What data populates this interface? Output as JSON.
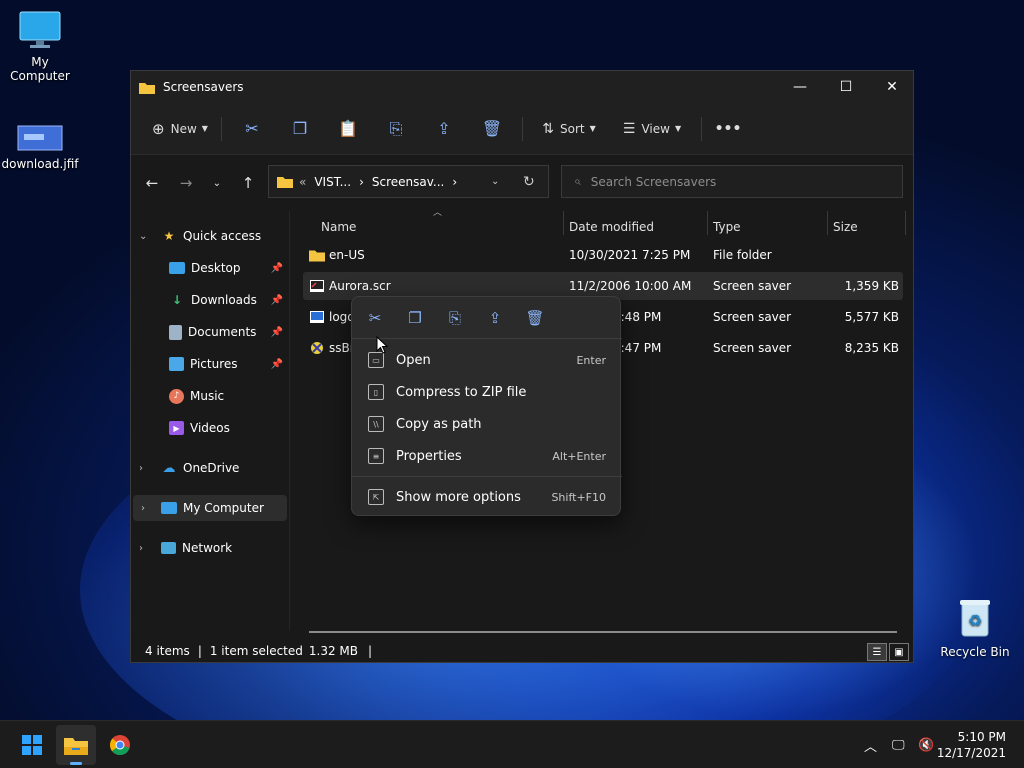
{
  "desktop": {
    "icons": [
      {
        "label": "My Computer",
        "icon": "monitor-icon"
      },
      {
        "label": "download.jfif",
        "icon": "image-file-icon"
      },
      {
        "label": "Recycle Bin",
        "icon": "recycle-bin-icon"
      }
    ]
  },
  "window": {
    "title": "Screensavers",
    "controls": {
      "minimize": "—",
      "maximize": "☐",
      "close": "✕"
    },
    "toolbar": {
      "new_label": "New",
      "sort_label": "Sort",
      "view_label": "View",
      "more_label": "•••"
    },
    "address": {
      "crumbs": [
        "«",
        "VIST...",
        "›",
        "Screensav...",
        "›"
      ]
    },
    "search": {
      "placeholder": "Search Screensavers"
    },
    "sidebar": {
      "quick_access": "Quick access",
      "items": [
        {
          "label": "Desktop",
          "icon": "desktop-icon",
          "pinned": true
        },
        {
          "label": "Downloads",
          "icon": "downloads-icon",
          "pinned": true
        },
        {
          "label": "Documents",
          "icon": "documents-icon",
          "pinned": true
        },
        {
          "label": "Pictures",
          "icon": "pictures-icon",
          "pinned": true
        },
        {
          "label": "Music",
          "icon": "music-icon",
          "pinned": false
        },
        {
          "label": "Videos",
          "icon": "videos-icon",
          "pinned": false
        }
      ],
      "onedrive": "OneDrive",
      "my_computer": "My Computer",
      "network": "Network"
    },
    "columns": {
      "name": "Name",
      "date": "Date modified",
      "type": "Type",
      "size": "Size"
    },
    "files": [
      {
        "name": "en-US",
        "date": "10/30/2021 7:25 PM",
        "type": "File folder",
        "size": ""
      },
      {
        "name": "Aurora.scr",
        "date": "11/2/2006 10:00 AM",
        "type": "Screen saver",
        "size": "1,359 KB"
      },
      {
        "name": "logo",
        "date": "9:48 PM",
        "type": "Screen saver",
        "size": "5,577 KB"
      },
      {
        "name": "ssBra",
        "date": "9:47 PM",
        "type": "Screen saver",
        "size": "8,235 KB"
      }
    ],
    "status": {
      "items": "4 items",
      "sep": "|",
      "selected": "1 item selected",
      "size": "1.32 MB",
      "sep2": "|"
    }
  },
  "context_menu": {
    "items": [
      {
        "label": "Open",
        "shortcut": "Enter"
      },
      {
        "label": "Compress to ZIP file",
        "shortcut": ""
      },
      {
        "label": "Copy as path",
        "shortcut": ""
      },
      {
        "label": "Properties",
        "shortcut": "Alt+Enter"
      },
      {
        "label": "Show more options",
        "shortcut": "Shift+F10"
      }
    ]
  },
  "taskbar": {
    "time": "5:10 PM",
    "date": "12/17/2021"
  },
  "colors": {
    "accent": "#0078d4",
    "folder": "#f5c542",
    "window_bg": "#191919",
    "menu_bg": "#2b2b2b"
  }
}
